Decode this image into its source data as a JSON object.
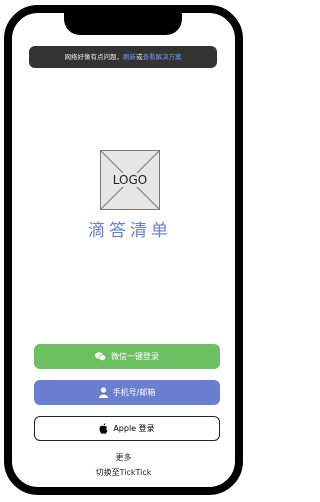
{
  "banner": {
    "text_before": "网络好像有点问题，",
    "link_refresh": "刷新",
    "text_or": "或",
    "link_solution": "查看解决方案"
  },
  "logo": {
    "label": "LOGO"
  },
  "brand": {
    "name": "滴答清单"
  },
  "buttons": {
    "wechat_label": "微信一键登录",
    "phone_label": "手机号/邮箱",
    "apple_label": "Apple 登录"
  },
  "footer": {
    "more_label": "更多",
    "switch_label": "切换至TickTick"
  },
  "icons": {
    "wechat": "wechat-icon",
    "user": "user-icon",
    "apple": "apple-icon"
  },
  "colors": {
    "wechat_green": "#6cc062",
    "brand_blue": "#6a7fd1",
    "banner_bg": "#333333",
    "link_blue": "#7b93ff"
  }
}
